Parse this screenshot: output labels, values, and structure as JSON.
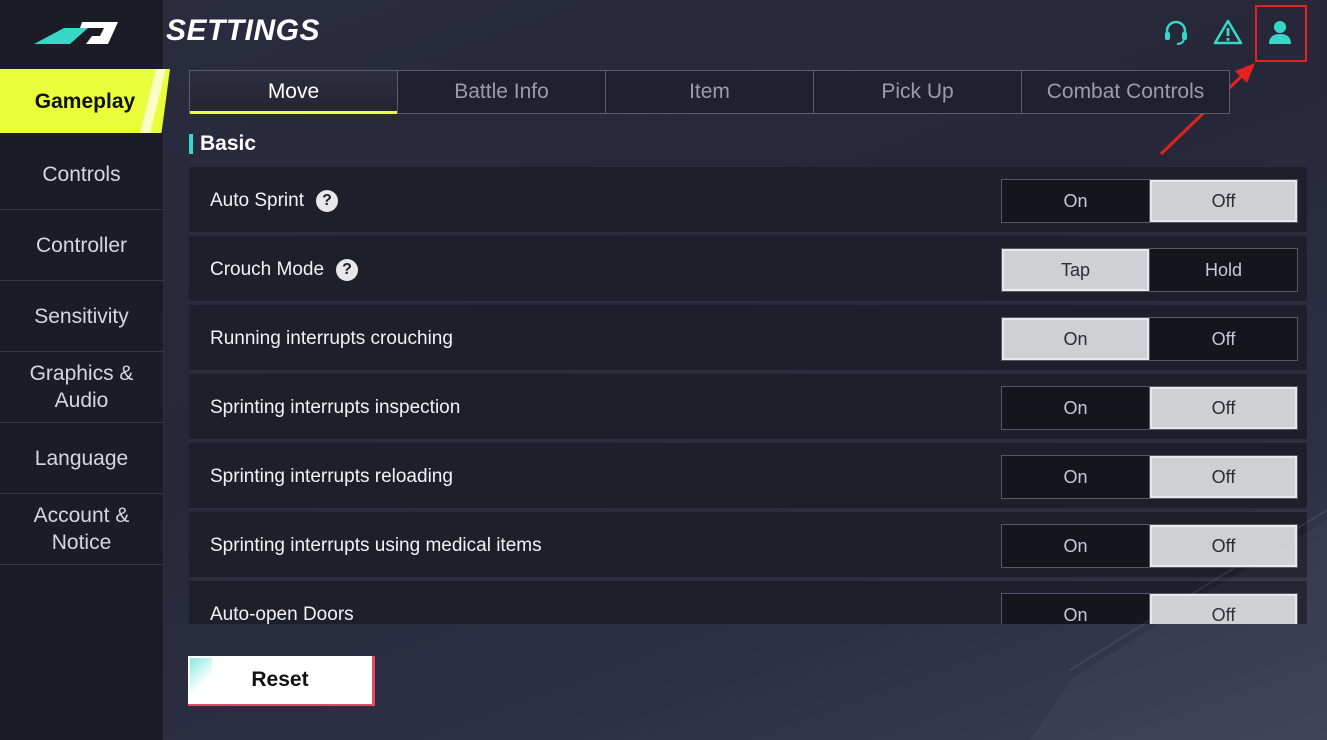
{
  "app": {
    "title": "SETTINGS"
  },
  "sidebar": {
    "items": [
      {
        "label": "Gameplay",
        "active": true
      },
      {
        "label": "Controls"
      },
      {
        "label": "Controller"
      },
      {
        "label": "Sensitivity"
      },
      {
        "label": "Graphics &\nAudio"
      },
      {
        "label": "Language"
      },
      {
        "label": "Account &\nNotice"
      }
    ]
  },
  "header_icons": [
    "headset-icon",
    "warning-icon",
    "profile-icon"
  ],
  "tabs": [
    {
      "label": "Move",
      "active": true
    },
    {
      "label": "Battle Info"
    },
    {
      "label": "Item"
    },
    {
      "label": "Pick Up"
    },
    {
      "label": "Combat Controls"
    }
  ],
  "section": {
    "title": "Basic"
  },
  "settings": [
    {
      "label": "Auto Sprint",
      "help": true,
      "options": [
        "On",
        "Off"
      ],
      "selected": 1
    },
    {
      "label": "Crouch Mode",
      "help": true,
      "options": [
        "Tap",
        "Hold"
      ],
      "selected": 0
    },
    {
      "label": "Running interrupts crouching",
      "help": false,
      "options": [
        "On",
        "Off"
      ],
      "selected": 0
    },
    {
      "label": "Sprinting interrupts inspection",
      "help": false,
      "options": [
        "On",
        "Off"
      ],
      "selected": 1
    },
    {
      "label": "Sprinting interrupts reloading",
      "help": false,
      "options": [
        "On",
        "Off"
      ],
      "selected": 1
    },
    {
      "label": "Sprinting interrupts using medical items",
      "help": false,
      "options": [
        "On",
        "Off"
      ],
      "selected": 1
    },
    {
      "label": "Auto-open Doors",
      "help": false,
      "options": [
        "On",
        "Off"
      ],
      "selected": 1
    }
  ],
  "reset": {
    "label": "Reset"
  },
  "colors": {
    "accent_yellow": "#e9ff3b",
    "accent_teal": "#37d7c8",
    "highlight_red": "#e5211f"
  }
}
